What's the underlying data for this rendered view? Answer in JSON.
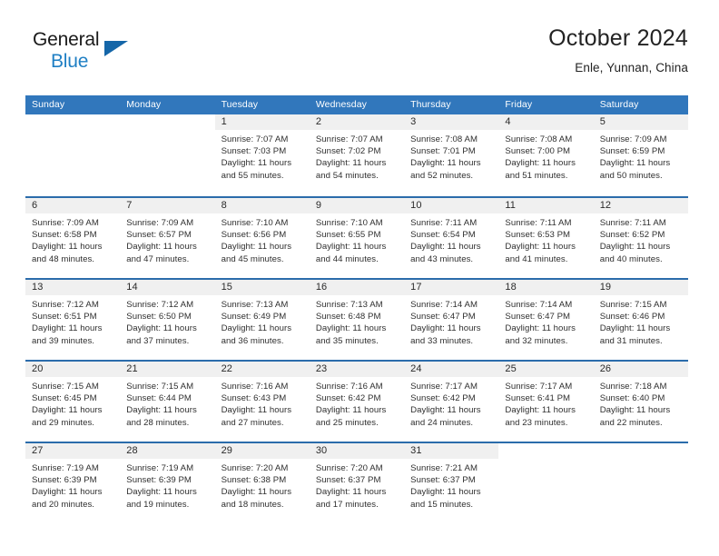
{
  "brand": {
    "name_part1": "General",
    "name_part2": "Blue",
    "logo_icon": "blue-triangle-logo"
  },
  "header": {
    "title": "October 2024",
    "location": "Enle, Yunnan, China"
  },
  "theme": {
    "header_blue": "#3177bc",
    "row_border_blue": "#2b6cab",
    "day_band_gray": "#f0f0f0",
    "brand_blue": "#1f7fc4",
    "text_dark": "#2a2a2a"
  },
  "calendar": {
    "weekday_headers": [
      "Sunday",
      "Monday",
      "Tuesday",
      "Wednesday",
      "Thursday",
      "Friday",
      "Saturday"
    ],
    "weeks": [
      [
        {
          "day": "",
          "lines": []
        },
        {
          "day": "",
          "lines": []
        },
        {
          "day": "1",
          "lines": [
            "Sunrise: 7:07 AM",
            "Sunset: 7:03 PM",
            "Daylight: 11 hours",
            "and 55 minutes."
          ]
        },
        {
          "day": "2",
          "lines": [
            "Sunrise: 7:07 AM",
            "Sunset: 7:02 PM",
            "Daylight: 11 hours",
            "and 54 minutes."
          ]
        },
        {
          "day": "3",
          "lines": [
            "Sunrise: 7:08 AM",
            "Sunset: 7:01 PM",
            "Daylight: 11 hours",
            "and 52 minutes."
          ]
        },
        {
          "day": "4",
          "lines": [
            "Sunrise: 7:08 AM",
            "Sunset: 7:00 PM",
            "Daylight: 11 hours",
            "and 51 minutes."
          ]
        },
        {
          "day": "5",
          "lines": [
            "Sunrise: 7:09 AM",
            "Sunset: 6:59 PM",
            "Daylight: 11 hours",
            "and 50 minutes."
          ]
        }
      ],
      [
        {
          "day": "6",
          "lines": [
            "Sunrise: 7:09 AM",
            "Sunset: 6:58 PM",
            "Daylight: 11 hours",
            "and 48 minutes."
          ]
        },
        {
          "day": "7",
          "lines": [
            "Sunrise: 7:09 AM",
            "Sunset: 6:57 PM",
            "Daylight: 11 hours",
            "and 47 minutes."
          ]
        },
        {
          "day": "8",
          "lines": [
            "Sunrise: 7:10 AM",
            "Sunset: 6:56 PM",
            "Daylight: 11 hours",
            "and 45 minutes."
          ]
        },
        {
          "day": "9",
          "lines": [
            "Sunrise: 7:10 AM",
            "Sunset: 6:55 PM",
            "Daylight: 11 hours",
            "and 44 minutes."
          ]
        },
        {
          "day": "10",
          "lines": [
            "Sunrise: 7:11 AM",
            "Sunset: 6:54 PM",
            "Daylight: 11 hours",
            "and 43 minutes."
          ]
        },
        {
          "day": "11",
          "lines": [
            "Sunrise: 7:11 AM",
            "Sunset: 6:53 PM",
            "Daylight: 11 hours",
            "and 41 minutes."
          ]
        },
        {
          "day": "12",
          "lines": [
            "Sunrise: 7:11 AM",
            "Sunset: 6:52 PM",
            "Daylight: 11 hours",
            "and 40 minutes."
          ]
        }
      ],
      [
        {
          "day": "13",
          "lines": [
            "Sunrise: 7:12 AM",
            "Sunset: 6:51 PM",
            "Daylight: 11 hours",
            "and 39 minutes."
          ]
        },
        {
          "day": "14",
          "lines": [
            "Sunrise: 7:12 AM",
            "Sunset: 6:50 PM",
            "Daylight: 11 hours",
            "and 37 minutes."
          ]
        },
        {
          "day": "15",
          "lines": [
            "Sunrise: 7:13 AM",
            "Sunset: 6:49 PM",
            "Daylight: 11 hours",
            "and 36 minutes."
          ]
        },
        {
          "day": "16",
          "lines": [
            "Sunrise: 7:13 AM",
            "Sunset: 6:48 PM",
            "Daylight: 11 hours",
            "and 35 minutes."
          ]
        },
        {
          "day": "17",
          "lines": [
            "Sunrise: 7:14 AM",
            "Sunset: 6:47 PM",
            "Daylight: 11 hours",
            "and 33 minutes."
          ]
        },
        {
          "day": "18",
          "lines": [
            "Sunrise: 7:14 AM",
            "Sunset: 6:47 PM",
            "Daylight: 11 hours",
            "and 32 minutes."
          ]
        },
        {
          "day": "19",
          "lines": [
            "Sunrise: 7:15 AM",
            "Sunset: 6:46 PM",
            "Daylight: 11 hours",
            "and 31 minutes."
          ]
        }
      ],
      [
        {
          "day": "20",
          "lines": [
            "Sunrise: 7:15 AM",
            "Sunset: 6:45 PM",
            "Daylight: 11 hours",
            "and 29 minutes."
          ]
        },
        {
          "day": "21",
          "lines": [
            "Sunrise: 7:15 AM",
            "Sunset: 6:44 PM",
            "Daylight: 11 hours",
            "and 28 minutes."
          ]
        },
        {
          "day": "22",
          "lines": [
            "Sunrise: 7:16 AM",
            "Sunset: 6:43 PM",
            "Daylight: 11 hours",
            "and 27 minutes."
          ]
        },
        {
          "day": "23",
          "lines": [
            "Sunrise: 7:16 AM",
            "Sunset: 6:42 PM",
            "Daylight: 11 hours",
            "and 25 minutes."
          ]
        },
        {
          "day": "24",
          "lines": [
            "Sunrise: 7:17 AM",
            "Sunset: 6:42 PM",
            "Daylight: 11 hours",
            "and 24 minutes."
          ]
        },
        {
          "day": "25",
          "lines": [
            "Sunrise: 7:17 AM",
            "Sunset: 6:41 PM",
            "Daylight: 11 hours",
            "and 23 minutes."
          ]
        },
        {
          "day": "26",
          "lines": [
            "Sunrise: 7:18 AM",
            "Sunset: 6:40 PM",
            "Daylight: 11 hours",
            "and 22 minutes."
          ]
        }
      ],
      [
        {
          "day": "27",
          "lines": [
            "Sunrise: 7:19 AM",
            "Sunset: 6:39 PM",
            "Daylight: 11 hours",
            "and 20 minutes."
          ]
        },
        {
          "day": "28",
          "lines": [
            "Sunrise: 7:19 AM",
            "Sunset: 6:39 PM",
            "Daylight: 11 hours",
            "and 19 minutes."
          ]
        },
        {
          "day": "29",
          "lines": [
            "Sunrise: 7:20 AM",
            "Sunset: 6:38 PM",
            "Daylight: 11 hours",
            "and 18 minutes."
          ]
        },
        {
          "day": "30",
          "lines": [
            "Sunrise: 7:20 AM",
            "Sunset: 6:37 PM",
            "Daylight: 11 hours",
            "and 17 minutes."
          ]
        },
        {
          "day": "31",
          "lines": [
            "Sunrise: 7:21 AM",
            "Sunset: 6:37 PM",
            "Daylight: 11 hours",
            "and 15 minutes."
          ]
        },
        {
          "day": "",
          "lines": []
        },
        {
          "day": "",
          "lines": []
        }
      ]
    ]
  }
}
